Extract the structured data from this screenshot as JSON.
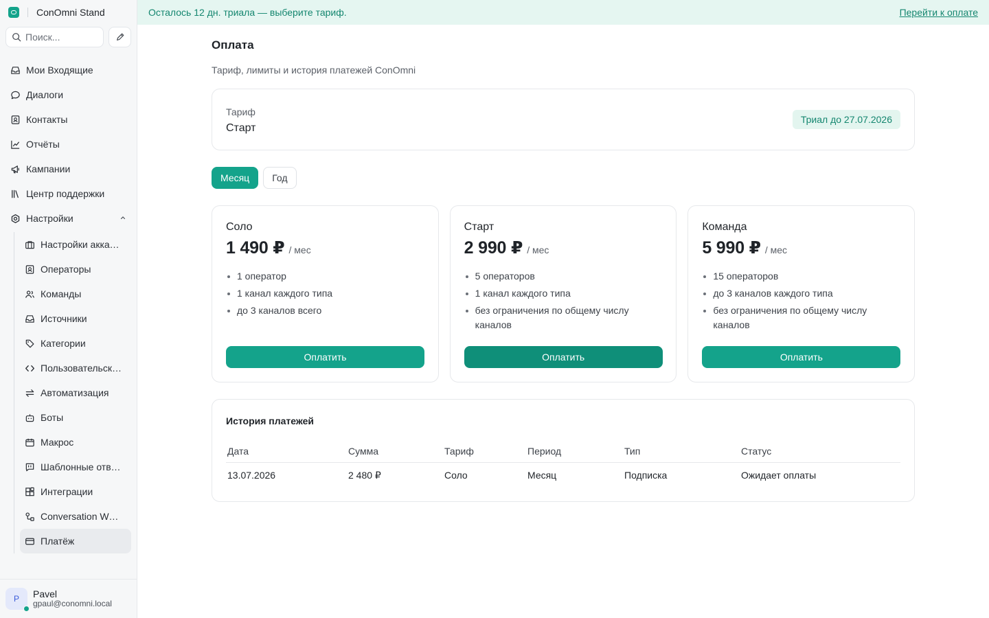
{
  "brand": {
    "name": "ConOmni Stand"
  },
  "search": {
    "placeholder": "Поиск..."
  },
  "nav": {
    "items": [
      {
        "label": "Мои Входящие",
        "icon": "inbox-icon"
      },
      {
        "label": "Диалоги",
        "icon": "chat-bubble-icon"
      },
      {
        "label": "Контакты",
        "icon": "contact-card-icon"
      },
      {
        "label": "Отчёты",
        "icon": "line-chart-icon"
      },
      {
        "label": "Кампании",
        "icon": "megaphone-icon"
      },
      {
        "label": "Центр поддержки",
        "icon": "library-icon"
      }
    ],
    "settings": {
      "label": "Настройки",
      "icon": "settings-icon"
    }
  },
  "settings_items": [
    {
      "label": "Настройки аккаунта",
      "icon": "briefcase-icon"
    },
    {
      "label": "Операторы",
      "icon": "contact-card-icon"
    },
    {
      "label": "Команды",
      "icon": "users-icon"
    },
    {
      "label": "Источники",
      "icon": "inbox-icon"
    },
    {
      "label": "Категории",
      "icon": "tag-icon"
    },
    {
      "label": "Пользовательские атрибуты",
      "icon": "code-icon"
    },
    {
      "label": "Автоматизация",
      "icon": "arrows-swap-icon"
    },
    {
      "label": "Боты",
      "icon": "bot-icon"
    },
    {
      "label": "Макрос",
      "icon": "calendar-icon"
    },
    {
      "label": "Шаблонные ответы",
      "icon": "quote-message-icon"
    },
    {
      "label": "Интеграции",
      "icon": "puzzle-icon"
    },
    {
      "label": "Conversation Workflows",
      "icon": "workflow-icon"
    },
    {
      "label": "Платёж",
      "icon": "credit-card-icon"
    }
  ],
  "user": {
    "initial": "P",
    "name": "Pavel",
    "email": "gpaul@conomni.local"
  },
  "banner": {
    "text": "Осталось 12 дн. триала — выберите тариф.",
    "link": "Перейти к оплате"
  },
  "page": {
    "title": "Оплата",
    "subtitle": "Тариф, лимиты и история платежей ConOmni"
  },
  "tariff": {
    "label": "Тариф",
    "name": "Старт",
    "badge": "Триал до 27.07.2026"
  },
  "period_toggle": {
    "month": "Месяц",
    "year": "Год",
    "selected": "Месяц"
  },
  "plans": [
    {
      "name": "Соло",
      "price": "1 490 ₽",
      "per": "/ мес",
      "features": [
        "1 оператор",
        "1 канал каждого типа",
        "до 3 каналов всего"
      ],
      "button": "Оплатить"
    },
    {
      "name": "Старт",
      "price": "2 990 ₽",
      "per": "/ мес",
      "features": [
        "5 операторов",
        "1 канал каждого типа",
        "без ограничения по общему числу каналов"
      ],
      "button": "Оплатить"
    },
    {
      "name": "Команда",
      "price": "5 990 ₽",
      "per": "/ мес",
      "features": [
        "15 операторов",
        "до 3 каналов каждого типа",
        "без ограничения по общему числу каналов"
      ],
      "button": "Оплатить"
    }
  ],
  "history": {
    "title": "История платежей",
    "columns": [
      "Дата",
      "Сумма",
      "Тариф",
      "Период",
      "Тип",
      "Статус"
    ],
    "rows": [
      [
        "13.07.2026",
        "2 480 ₽",
        "Соло",
        "Месяц",
        "Подписка",
        "Ожидает оплаты"
      ]
    ]
  },
  "colors": {
    "accent": "#14a38b",
    "accent_dark": "#0f8f79",
    "banner_bg": "#e5f6f1",
    "banner_text": "#14866f"
  }
}
